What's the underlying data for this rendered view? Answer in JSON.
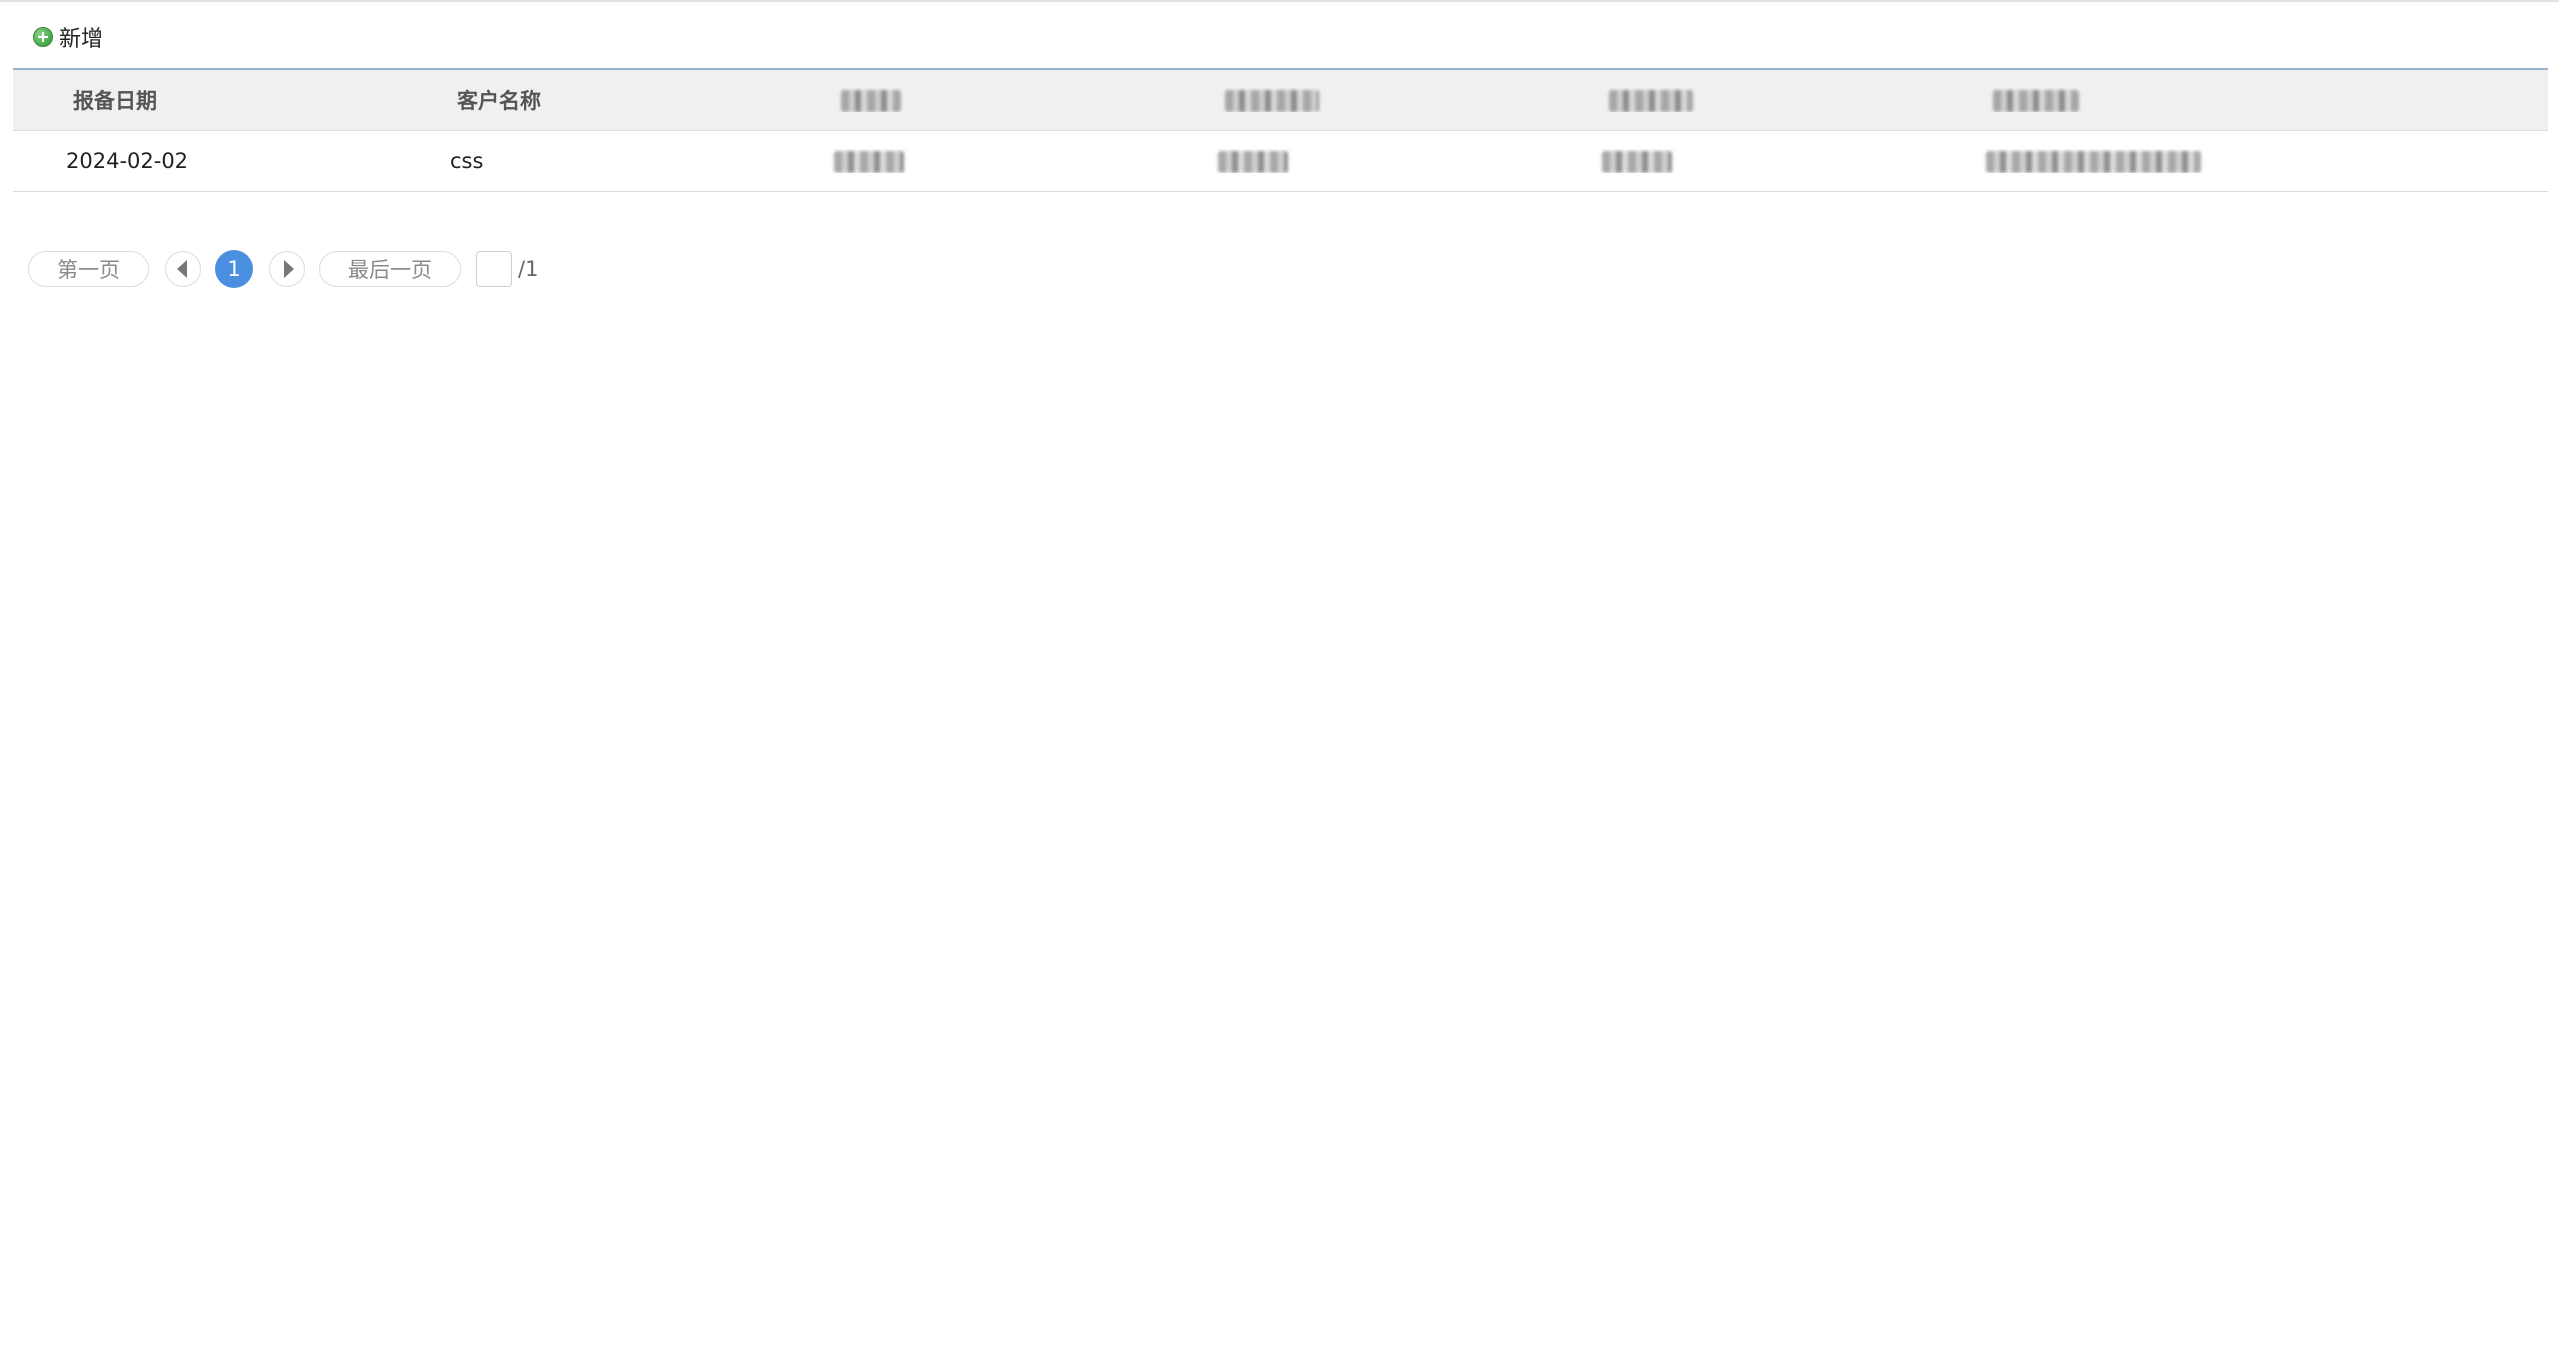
{
  "toolbar": {
    "add_label": "新增",
    "add_icon": "plus-circle-icon"
  },
  "table": {
    "headers": [
      "报备日期",
      "客户名称",
      "",
      "",
      "",
      ""
    ],
    "rows": [
      [
        "2024-02-02",
        "css",
        "",
        "",
        "",
        ""
      ]
    ]
  },
  "pager": {
    "first_label": "第一页",
    "last_label": "最后一页",
    "current_page": "1",
    "total_pages": "/1",
    "jump_value": ""
  },
  "colors": {
    "accent": "#4a8fe0",
    "add_icon_green": "#4caf50",
    "header_bg": "#f0f0f0",
    "table_top_border": "#9ab3c9"
  }
}
